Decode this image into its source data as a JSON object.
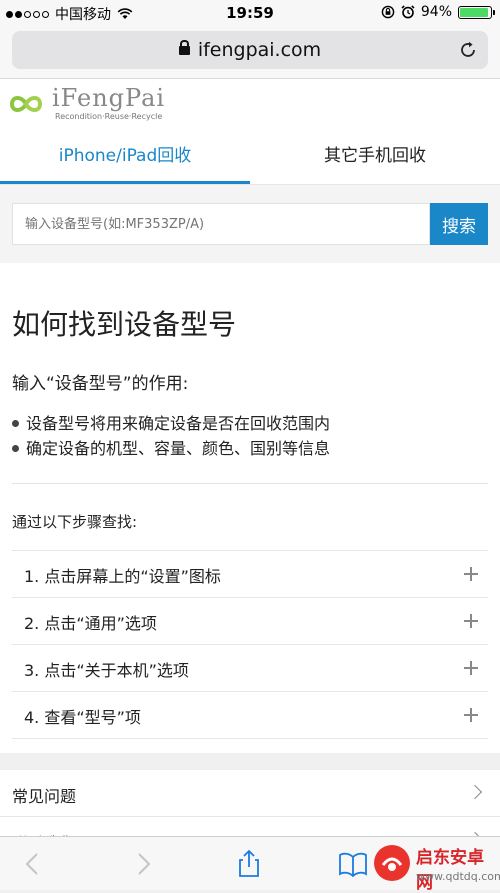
{
  "status_bar": {
    "carrier": "中国移动",
    "time": "19:59",
    "battery": "94%",
    "battery_level": 0.94
  },
  "browser": {
    "url": "ifengpai.com"
  },
  "header": {
    "logo_text": "iFengPai",
    "tagline": "Recondition·Reuse·Recycle",
    "brand_colors": {
      "green": "#8cc63f",
      "blue": "#1a87c9"
    }
  },
  "tabs": [
    {
      "label": "iPhone/iPad回收",
      "active": true
    },
    {
      "label": "其它手机回收",
      "active": false
    }
  ],
  "search": {
    "placeholder": "输入设备型号(如:MF353ZP/A)",
    "button_label": "搜索"
  },
  "guide": {
    "title": "如何找到设备型号",
    "purpose_heading": "输入“设备型号”的作用:",
    "purpose_items": [
      "设备型号将用来确定设备是否在回收范围内",
      "确定设备的机型、容量、颜色、国别等信息"
    ],
    "steps_heading": "通过以下步骤查找:",
    "steps": [
      "1. 点击屏幕上的“设置”图标",
      "2. 点击“通用”选项",
      "3. 点击“关于本机”选项",
      "4. 查看“型号”项"
    ]
  },
  "faq": {
    "items": [
      "常见问题",
      "联系我们"
    ]
  },
  "watermark": {
    "title": "启东安卓网",
    "url": "www.qdtdq.com"
  },
  "accent_color": "#1a87c9"
}
